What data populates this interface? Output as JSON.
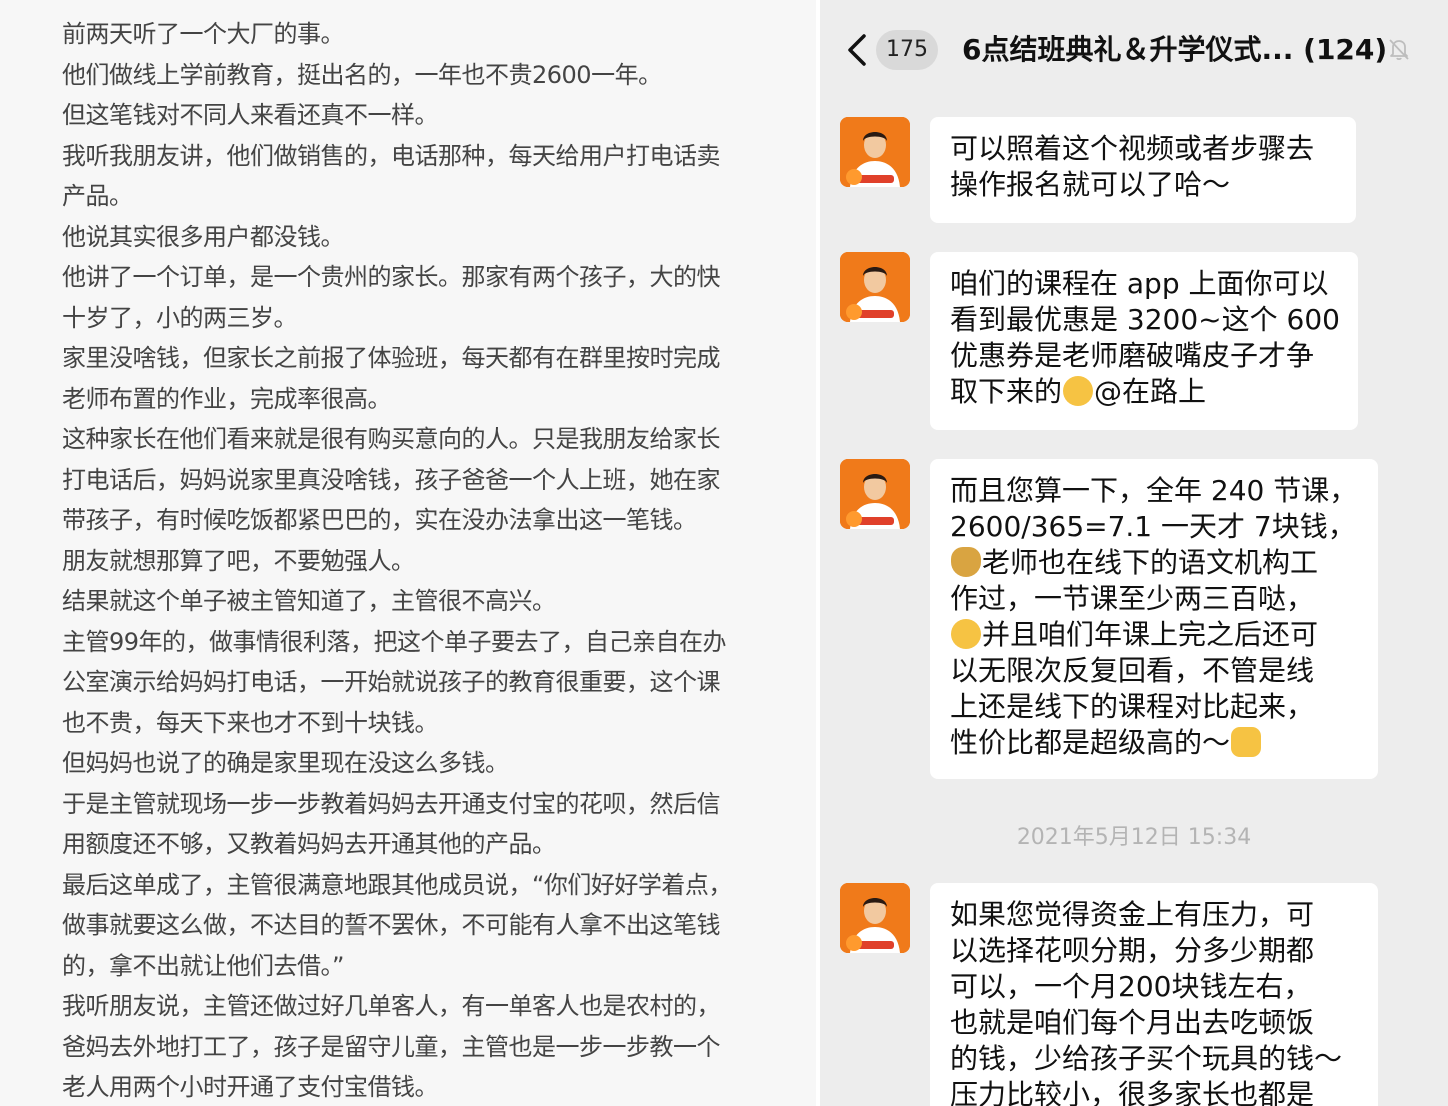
{
  "article": {
    "lines": [
      "前两天听了一个大厂的事。",
      "他们做线上学前教育，挺出名的，一年也不贵2600一年。",
      "但这笔钱对不同人来看还真不一样。",
      "我听我朋友讲，他们做销售的，电话那种，每天给用户打电话卖",
      "产品。",
      "他说其实很多用户都没钱。",
      "他讲了一个订单，是一个贵州的家长。那家有两个孩子，大的快",
      "十岁了，小的两三岁。",
      "家里没啥钱，但家长之前报了体验班，每天都有在群里按时完成",
      "老师布置的作业，完成率很高。",
      "这种家长在他们看来就是很有购买意向的人。只是我朋友给家长",
      "打电话后，妈妈说家里真没啥钱，孩子爸爸一个人上班，她在家",
      "带孩子，有时候吃饭都紧巴巴的，实在没办法拿出这一笔钱。",
      "朋友就想那算了吧，不要勉强人。",
      "结果就这个单子被主管知道了，主管很不高兴。",
      "主管99年的，做事情很利落，把这个单子要去了，自己亲自在办",
      "公室演示给妈妈打电话，一开始就说孩子的教育很重要，这个课",
      "也不贵，每天下来也才不到十块钱。",
      "但妈妈也说了的确是家里现在没这么多钱。",
      "于是主管就现场一步一步教着妈妈去开通支付宝的花呗，然后信",
      "用额度还不够，又教着妈妈去开通其他的产品。",
      "最后这单成了，主管很满意地跟其他成员说，“你们好好学着点，",
      "做事就要这么做，不达目的誓不罢休，不可能有人拿不出这笔钱",
      "的，拿不出就让他们去借。”",
      "我听朋友说，主管还做过好几单客人，有一单客人也是农村的，",
      "爸妈去外地打工了，孩子是留守儿童，主管也是一步一步教一个",
      "老人用两个小时开通了支付宝借钱。"
    ]
  },
  "chat": {
    "unread_count": "175",
    "title": "6点结班典礼＆升学仪式...  (124)",
    "icons": {
      "back": "chevron-left-icon",
      "mute": "bell-muted-icon",
      "emoji_laugh": "laughing-emoji-icon",
      "emoji_money": "money-bag-emoji-icon",
      "emoji_cry": "crying-laughing-emoji-icon",
      "emoji_thumb": "thumbs-up-emoji-icon"
    },
    "messages": [
      {
        "lines": [
          "可以照着这个视频或者步骤去",
          "操作报名就可以了哈～"
        ]
      },
      {
        "lines": [
          "咱们的课程在 app 上面你可以",
          "看到最优惠是 3200~这个 600",
          "优惠券是老师磨破嘴皮子才争",
          "取下来的",
          "@在路上"
        ]
      },
      {
        "lines": [
          "而且您算一下，全年 240 节课，",
          "2600/365=7.1 一天才 7块钱，",
          "老师也在线下的语文机构工",
          "作过，一节课至少两三百哒，",
          "并且咱们年课上完之后还可",
          "以无限次反复回看，不管是线",
          "上还是线下的课程对比起来，",
          "性价比都是超级高的～"
        ]
      },
      {
        "lines": [
          "如果您觉得资金上有压力，可",
          "以选择花呗分期，分多少期都",
          "可以，一个月200块钱左右，",
          "也就是咱们每个月出去吃顿饭",
          "的钱，少给孩子买个玩具的钱～",
          "压力比较小，很多家长也都是"
        ]
      }
    ],
    "timestamp": "2021年5月12日 15:34"
  }
}
